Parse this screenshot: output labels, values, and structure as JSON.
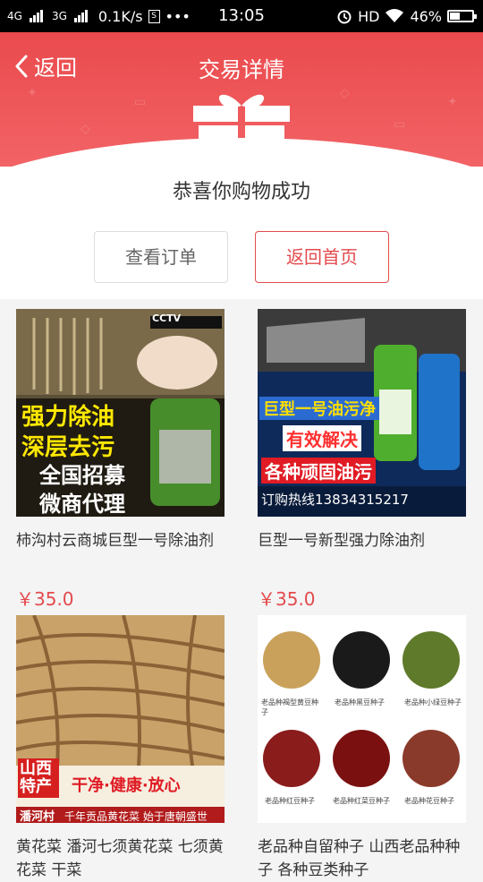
{
  "status": {
    "net1": "4G",
    "net2": "3G",
    "speed": "0.1K/s",
    "sim": "S",
    "dots": "•••",
    "time": "13:05",
    "hd": "HD",
    "battery": "46%"
  },
  "header": {
    "back_label": "返回",
    "title": "交易详情"
  },
  "success_message": "恭喜你购物成功",
  "buttons": {
    "view_order": "查看订单",
    "back_home": "返回首页"
  },
  "products": [
    {
      "name": "柿沟村云商城巨型一号除油剂",
      "price": "￥35.0",
      "img_text": [
        "强力除油",
        "深层去污",
        "全国招募",
        "微商代理"
      ],
      "img_badge": "CCTV"
    },
    {
      "name": "巨型一号新型强力除油剂",
      "price": "￥35.0",
      "img_text": [
        "巨型一号油污净",
        "有效解决",
        "各种顽固油污",
        "订购热线13834315217"
      ]
    },
    {
      "name": "黄花菜 潘河七须黄花菜 七须黄花菜 干菜",
      "price": "",
      "img_text": [
        "山西特产",
        "干净·健康·放心",
        "潘河村",
        "千年贡品黄花菜 始于唐朝盛世"
      ]
    },
    {
      "name": "老品种自留种子 山西老品种种子 各种豆类种子",
      "price": "",
      "img_text": [
        "老品种褐型黄豆种子",
        "老品种黑豆种子",
        "老品种小绿豆种子",
        "老品种红豆种子",
        "老品种红菜豆种子",
        "老品种花豆种子"
      ]
    }
  ],
  "colors": {
    "accent": "#e34a4d",
    "header": "#ea4a4d"
  }
}
